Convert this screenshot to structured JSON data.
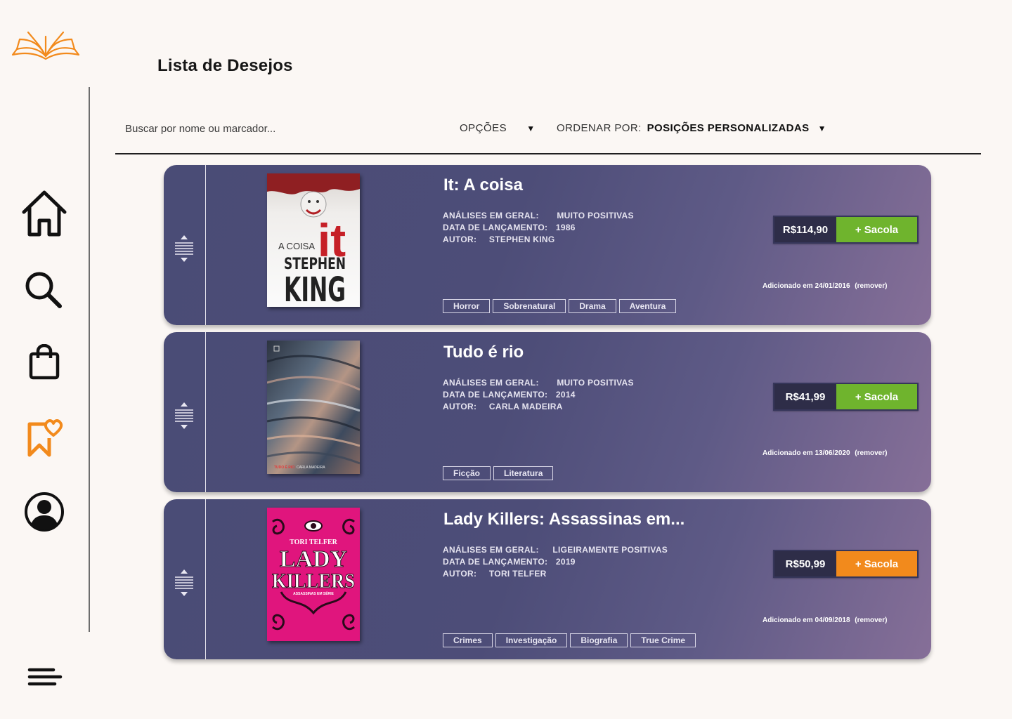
{
  "app": {
    "logo_icon": "open-book-logo",
    "accent": "#f28a1c"
  },
  "sidebar": {
    "items": [
      {
        "name": "home",
        "icon": "home-icon"
      },
      {
        "name": "search",
        "icon": "search-icon"
      },
      {
        "name": "bag",
        "icon": "shopping-bag-icon"
      },
      {
        "name": "wishlist",
        "icon": "bookmark-heart-icon",
        "active": true
      },
      {
        "name": "profile",
        "icon": "user-circle-icon"
      }
    ],
    "menu_icon": "menu-icon"
  },
  "header": {
    "title": "Lista de Desejos"
  },
  "toolbar": {
    "search_placeholder": "Buscar por nome ou marcador...",
    "options_label": "OPÇÕES",
    "sort_label": "ORDENAR POR:",
    "sort_value": "POSIÇÕES PERSONALIZADAS"
  },
  "books": [
    {
      "title": "It: A coisa",
      "reviews_label": "ANÁLISES EM GERAL:",
      "reviews": "MUITO POSITIVAS",
      "release_label": "DATA DE LANÇAMENTO:",
      "release": "1986",
      "author_label": "AUTOR:",
      "author": "STEPHEN KING",
      "price": "R$114,90",
      "cart_label": "+ Sacola",
      "cart_color": "#6fb42d",
      "added": "Adicionado em 24/01/2016",
      "remove": "(remover)",
      "tags": [
        "Horror",
        "Sobrenatural",
        "Drama",
        "Aventura"
      ],
      "cover": {
        "line1": "A COISA",
        "line2": "STEPHEN",
        "line3": "KING",
        "logo": "it"
      }
    },
    {
      "title": "Tudo é rio",
      "reviews_label": "ANÁLISES EM GERAL:",
      "reviews": "MUITO POSITIVAS",
      "release_label": "DATA DE LANÇAMENTO:",
      "release": "2014",
      "author_label": "AUTOR:",
      "author": "CARLA MADEIRA",
      "price": "R$41,99",
      "cart_label": "+ Sacola",
      "cart_color": "#6fb42d",
      "added": "Adicionado em 13/06/2020",
      "remove": "(remover)",
      "tags": [
        "Ficção",
        "Literatura"
      ],
      "cover": {
        "line1": "TUDO É RIO",
        "line2": "CARLA MADEIRA"
      }
    },
    {
      "title": "Lady Killers: Assassinas em...",
      "reviews_label": "ANÁLISES EM GERAL:",
      "reviews": "LIGEIRAMENTE POSITIVAS",
      "release_label": "DATA DE LANÇAMENTO:",
      "release": "2019",
      "author_label": "AUTOR:",
      "author": "TORI TELFER",
      "price": "R$50,99",
      "cart_label": "+ Sacola",
      "cart_color": "#f28a1c",
      "added": "Adicionado em 04/09/2018",
      "remove": "(remover)",
      "tags": [
        "Crimes",
        "Investigação",
        "Biografia",
        "True Crime"
      ],
      "cover": {
        "line1": "TORI TELFER",
        "line2": "LADY",
        "line3": "KILLERS",
        "line4": "ASSASSINAS EM SÉRIE"
      }
    }
  ]
}
